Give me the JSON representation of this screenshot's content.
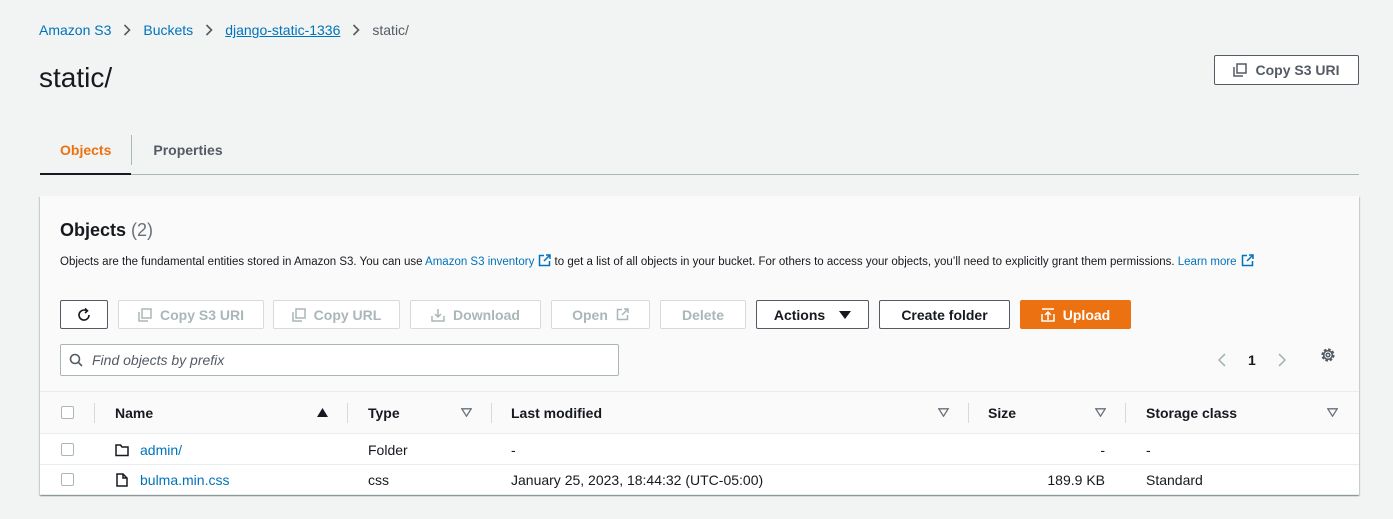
{
  "breadcrumb": [
    {
      "label": "Amazon S3"
    },
    {
      "label": "Buckets"
    },
    {
      "label": "django-static-1336"
    },
    {
      "label": "static/"
    }
  ],
  "page_title": "static/",
  "header_copy_uri": "Copy S3 URI",
  "tabs": [
    {
      "label": "Objects",
      "active": true
    },
    {
      "label": "Properties",
      "active": false
    }
  ],
  "objects_panel": {
    "title": "Objects",
    "count": "(2)",
    "description_pre": "Objects are the fundamental entities stored in Amazon S3. You can use ",
    "inventory_link": "Amazon S3 inventory",
    "description_mid": " to get a list of all objects in your bucket. For others to access your objects, you’ll need to explicitly grant them permissions. ",
    "learn_more": "Learn more"
  },
  "toolbar": {
    "refresh_icon": "refresh-icon",
    "copy_s3_uri": "Copy S3 URI",
    "copy_url": "Copy URL",
    "download": "Download",
    "open": "Open",
    "delete": "Delete",
    "actions": "Actions",
    "create_folder": "Create folder",
    "upload": "Upload"
  },
  "search": {
    "placeholder": "Find objects by prefix",
    "value": ""
  },
  "pagination": {
    "current_page": "1"
  },
  "table": {
    "columns": [
      "Name",
      "Type",
      "Last modified",
      "Size",
      "Storage class"
    ],
    "rows": [
      {
        "icon": "folder-icon",
        "name": "admin/",
        "type": "Folder",
        "last_modified": "-",
        "size": "-",
        "storage_class": "-"
      },
      {
        "icon": "file-icon",
        "name": "bulma.min.css",
        "type": "css",
        "last_modified": "January 25, 2023, 18:44:32 (UTC-05:00)",
        "size": "189.9 KB",
        "storage_class": "Standard"
      }
    ]
  },
  "colors": {
    "accent": "#ec7211",
    "link": "#0073bb",
    "text": "#16191f",
    "disabled": "#aab7b8"
  }
}
